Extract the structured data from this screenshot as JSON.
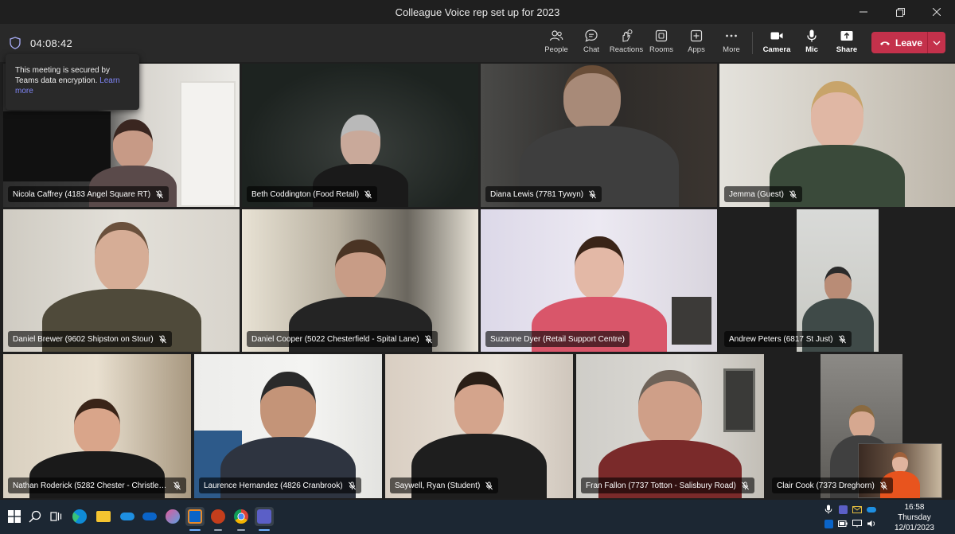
{
  "window": {
    "title": "Colleague Voice rep set up for 2023"
  },
  "toolbar": {
    "timer": "04:08:42",
    "buttons": {
      "people": "People",
      "chat": "Chat",
      "reactions": "Reactions",
      "rooms": "Rooms",
      "apps": "Apps",
      "more": "More",
      "camera": "Camera",
      "mic": "Mic",
      "share": "Share"
    },
    "leave": "Leave"
  },
  "tooltip": {
    "text": "This meeting is secured by Teams data encryption.",
    "link": "Learn more"
  },
  "participants": [
    {
      "name": "Nicola Caffrey (4183 Angel Square RT)"
    },
    {
      "name": "Beth Coddington (Food Retail)"
    },
    {
      "name": "Diana Lewis (7781 Tywyn)"
    },
    {
      "name": "Jemma (Guest)"
    },
    {
      "name": "Daniel Brewer (9602 Shipston on Stour)"
    },
    {
      "name": "Daniel Cooper (5022 Chesterfield - Spital Lane)"
    },
    {
      "name": "Suzanne Dyer (Retail Support Centre)"
    },
    {
      "name": "Andrew Peters (6817 St Just)"
    },
    {
      "name": "Nathan Roderick (5282 Chester - Christleton..."
    },
    {
      "name": "Laurence Hernandez (4826 Cranbrook)"
    },
    {
      "name": "Saywell, Ryan (Student)"
    },
    {
      "name": "Fran Fallon (7737 Totton - Salisbury Road)"
    },
    {
      "name": "Clair Cook (7373 Dreghorn)"
    }
  ],
  "taskbar": {
    "clock": {
      "time": "16:58",
      "day": "Thursday",
      "date": "12/01/2023"
    }
  },
  "colors": {
    "accent": "#7f85f5",
    "leave": "#c4314b",
    "toolbar": "#292929",
    "taskbar": "#1c2733"
  },
  "icons": [
    "shield-icon",
    "people-icon",
    "chat-icon",
    "reactions-icon",
    "rooms-icon",
    "apps-icon",
    "more-icon",
    "camera-icon",
    "mic-icon",
    "share-icon",
    "phone-icon",
    "chevron-down-icon",
    "mic-muted-icon",
    "windows-start-icon",
    "search-icon",
    "task-view-icon",
    "edge-icon",
    "file-explorer-icon",
    "onedrive-icon",
    "outlook-icon",
    "powerpoint-icon",
    "chrome-icon",
    "teams-icon"
  ]
}
